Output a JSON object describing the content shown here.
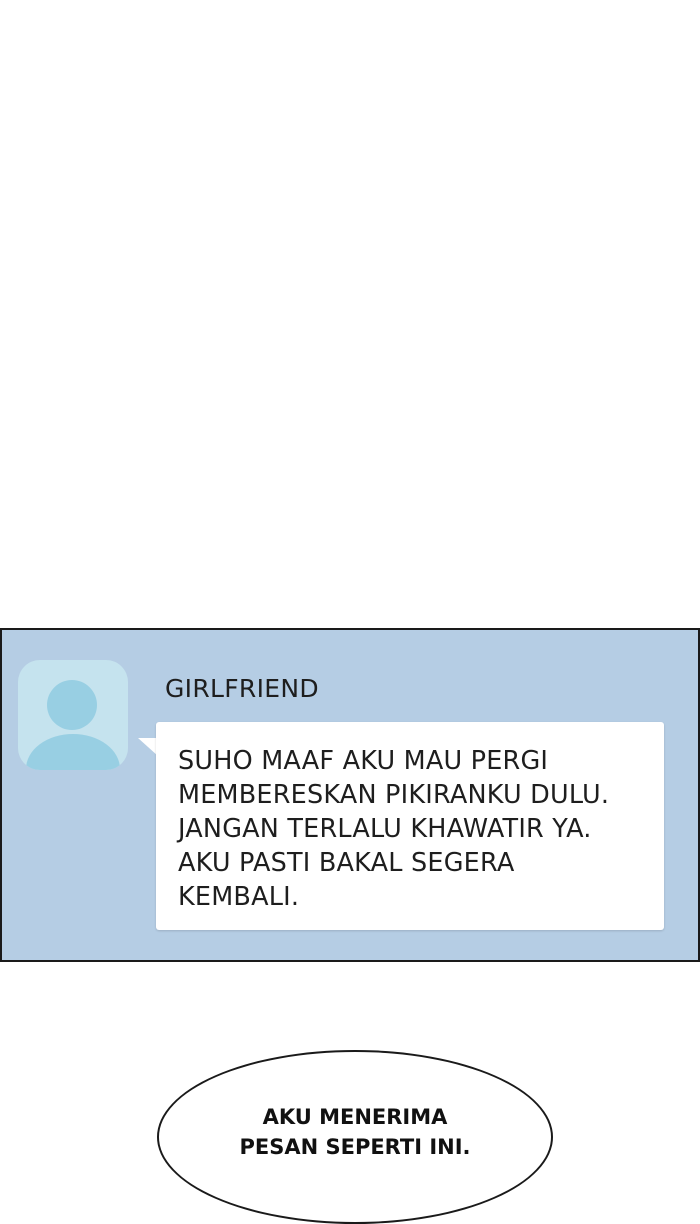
{
  "chat": {
    "sender_name": "GIRLFRIEND",
    "message": "SUHO MAAF AKU MAU PERGI\nMEMBERESKAN PIKIRANKU DULU.\nJANGAN TERLALU KHAWATIR YA.\nAKU PASTI BAKAL SEGERA\nKEMBALI.",
    "avatar_icon": "default-user-avatar-icon",
    "panel_color": "#b5cde4",
    "avatar_color": "#98cfe3"
  },
  "narration": {
    "text": "AKU MENERIMA\nPESAN SEPERTI INI."
  }
}
